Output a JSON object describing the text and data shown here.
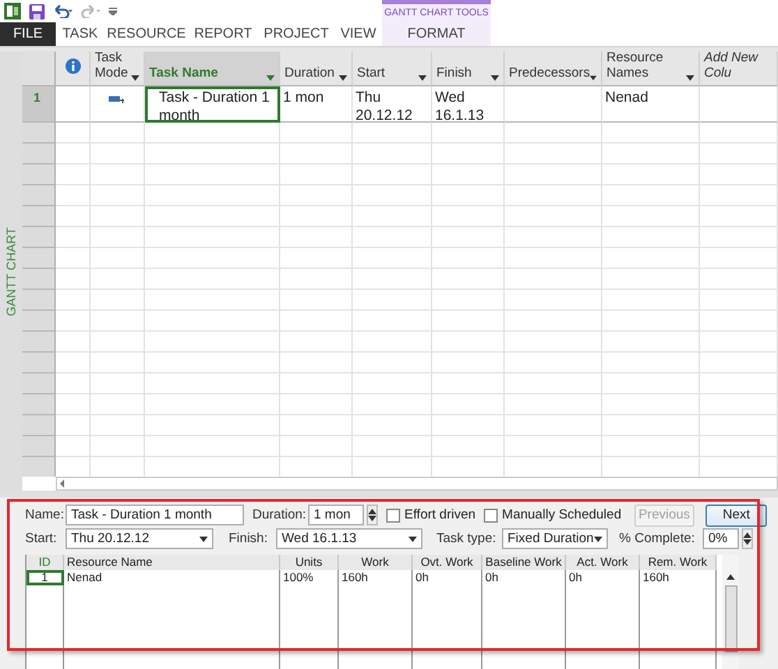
{
  "ribbon": {
    "context_group": "GANTT CHART TOOLS",
    "tabs": [
      {
        "label": "FILE",
        "kind": "file",
        "selected": false
      },
      {
        "label": "TASK",
        "kind": "normal",
        "selected": false
      },
      {
        "label": "RESOURCE",
        "kind": "normal",
        "selected": false
      },
      {
        "label": "REPORT",
        "kind": "normal",
        "selected": false
      },
      {
        "label": "PROJECT",
        "kind": "normal",
        "selected": false
      },
      {
        "label": "VIEW",
        "kind": "normal",
        "selected": false
      },
      {
        "label": "FORMAT",
        "kind": "contextual",
        "selected": false
      }
    ]
  },
  "view_bar": {
    "label": "GANTT CHART"
  },
  "table": {
    "columns": [
      {
        "kind": "info",
        "selected": false
      },
      {
        "label": "Task Mode",
        "kind": "filter",
        "selected": false
      },
      {
        "label": "Task Name",
        "kind": "filter",
        "selected": true
      },
      {
        "label": "Duration",
        "kind": "filter",
        "selected": false
      },
      {
        "label": "Start",
        "kind": "filter",
        "selected": false
      },
      {
        "label": "Finish",
        "kind": "filter",
        "selected": false
      },
      {
        "label": "Predecessors",
        "kind": "filter",
        "selected": false
      },
      {
        "label": "Resource Names",
        "kind": "filter",
        "selected": false
      },
      {
        "label": "Add New Colu",
        "kind": "add",
        "selected": false
      }
    ],
    "rows": [
      {
        "id": "1",
        "selected": true,
        "cells": [
          null,
          {
            "kind": "auto_scheduled",
            "active": false
          },
          {
            "text": "Task - Duration 1 month",
            "active": true
          },
          {
            "text": "1 mon",
            "active": false
          },
          {
            "text": "Thu 20.12.12",
            "active": false
          },
          {
            "text": "Wed 16.1.13",
            "active": false
          },
          null,
          {
            "text": "Nenad",
            "active": false
          },
          null
        ]
      }
    ]
  },
  "task_form": {
    "name": {
      "label": "Name:",
      "value": "Task - Duration 1 month"
    },
    "duration": {
      "label": "Duration:",
      "value": "1 mon"
    },
    "checkboxes": [
      {
        "label": "Effort driven",
        "checked": false
      },
      {
        "label": "Manually Scheduled",
        "checked": false
      }
    ],
    "buttons": [
      {
        "label": "Previous",
        "disabled": true
      },
      {
        "label": "Next",
        "disabled": false
      }
    ],
    "start": {
      "label": "Start:",
      "value": "Thu 20.12.12"
    },
    "finish": {
      "label": "Finish:",
      "value": "Wed 16.1.13"
    },
    "task_type": {
      "label": "Task type:",
      "value": "Fixed Duration"
    },
    "percent_complete": {
      "label": "% Complete:",
      "value": "0%"
    },
    "assignments": {
      "columns": [
        "ID",
        "Resource Name",
        "Units",
        "Work",
        "Ovt. Work",
        "Baseline Work",
        "Act. Work",
        "Rem. Work"
      ],
      "rows": [
        [
          "1",
          "Nenad",
          "100%",
          "160h",
          "0h",
          "0h",
          "0h",
          "160h"
        ]
      ]
    }
  }
}
